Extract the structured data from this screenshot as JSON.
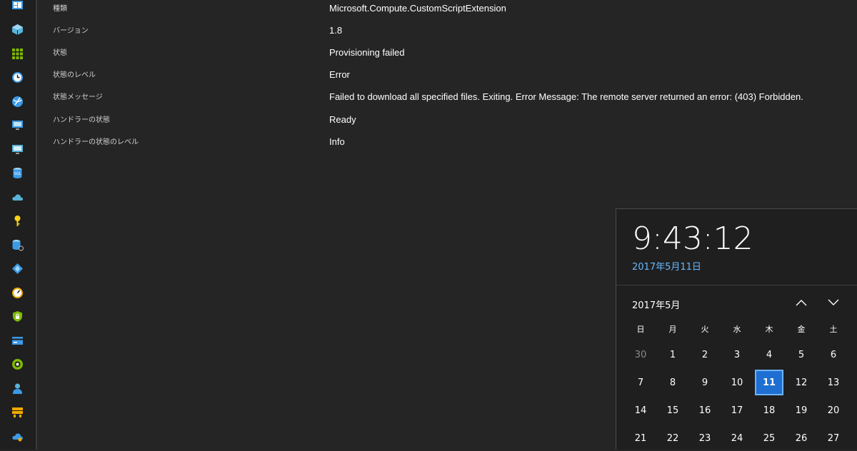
{
  "properties": [
    {
      "label": "種類",
      "value": "Microsoft.Compute.CustomScriptExtension"
    },
    {
      "label": "バージョン",
      "value": "1.8"
    },
    {
      "label": "状態",
      "value": "Provisioning failed"
    },
    {
      "label": "状態のレベル",
      "value": "Error"
    },
    {
      "label": "状態メッセージ",
      "value": "Failed to download all specified files. Exiting. Error Message: The remote server returned an error: (403) Forbidden."
    },
    {
      "label": "ハンドラーの状態",
      "value": "Ready"
    },
    {
      "label": "ハンドラーの状態のレベル",
      "value": "Info"
    }
  ],
  "sidebar_icons": [
    "dashboard-icon",
    "resource-group-icon",
    "all-resources-icon",
    "recent-icon",
    "app-services-icon",
    "virtual-machines-icon",
    "virtual-machines-classic-icon",
    "sql-database-icon",
    "cloud-services-icon",
    "key-vault-icon",
    "sql-server-icon",
    "azure-ad-icon",
    "monitor-icon",
    "security-center-icon",
    "cost-billing-icon",
    "advisor-icon",
    "help-support-icon",
    "storage-icon",
    "cloud-icon"
  ],
  "clock": {
    "time": "9:43:12",
    "date": "2017年5月11日"
  },
  "calendar": {
    "month_label": "2017年5月",
    "weekdays": [
      "日",
      "月",
      "火",
      "水",
      "木",
      "金",
      "土"
    ],
    "weeks": [
      [
        "30",
        "1",
        "2",
        "3",
        "4",
        "5",
        "6"
      ],
      [
        "7",
        "8",
        "9",
        "10",
        "11",
        "12",
        "13"
      ],
      [
        "14",
        "15",
        "16",
        "17",
        "18",
        "19",
        "20"
      ],
      [
        "21",
        "22",
        "23",
        "24",
        "25",
        "26",
        "27"
      ]
    ],
    "muted_days": [
      "30"
    ],
    "selected_day": "11"
  },
  "colors": {
    "accent": "#1e6fd1",
    "date_link": "#6ab7ff",
    "background": "#252526"
  }
}
